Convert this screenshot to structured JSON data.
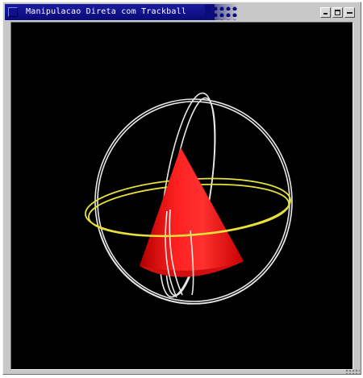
{
  "window": {
    "title": "Manipulacao Direta com Trackball",
    "menu_icon": "window-menu-icon",
    "buttons": {
      "minimize_icon": "minimize-icon",
      "maximize_icon": "maximize-icon",
      "close_icon": "close-icon"
    }
  },
  "scene": {
    "background_color": "#000000",
    "cone_color": "#ff1a1a",
    "trackball_ring_color": "#e8e8e8",
    "horizontal_ring_color": "#e6e03a"
  }
}
